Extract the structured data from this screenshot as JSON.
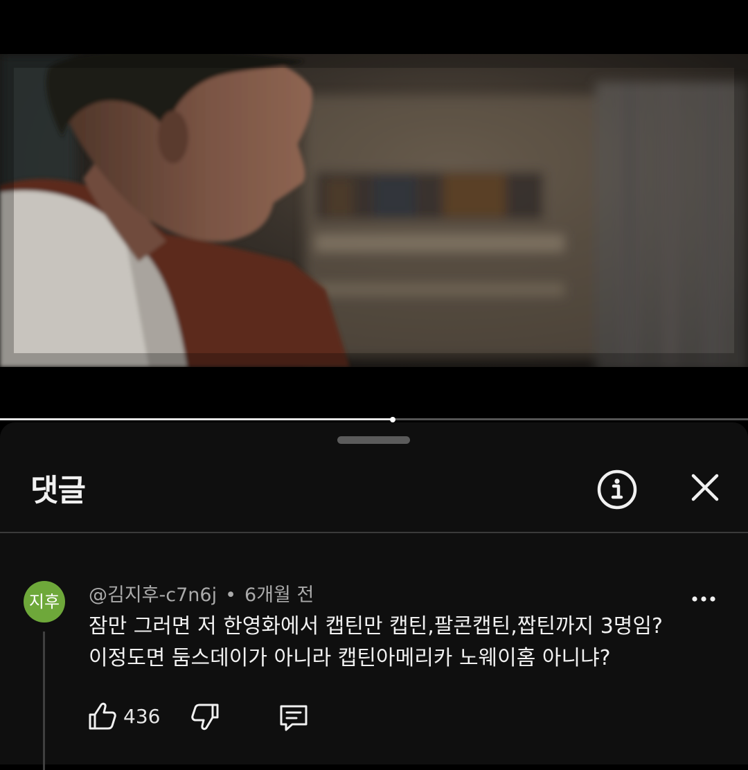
{
  "video": {
    "progress": 0.525
  },
  "comments_panel": {
    "title": "댓글",
    "icons": {
      "info": "info-circle-icon",
      "close": "close-icon",
      "more": "more-horizontal-icon",
      "like": "thumbs-up-icon",
      "dislike": "thumbs-down-icon",
      "reply": "reply-comment-icon"
    }
  },
  "comment": {
    "avatar_text": "지후",
    "avatar_color": "#6ea83a",
    "author": "@김지후-c7n6j",
    "separator": "•",
    "time": "6개월 전",
    "text_lines": [
      "잠만 그러면 저 한영화에서 캡틴만 캡틴,팔콘캡틴,짭틴까지 3명임?",
      "이정도면 둠스데이가 아니라 캡틴아메리카 노웨이홈 아니냐?"
    ],
    "likes": "436"
  }
}
